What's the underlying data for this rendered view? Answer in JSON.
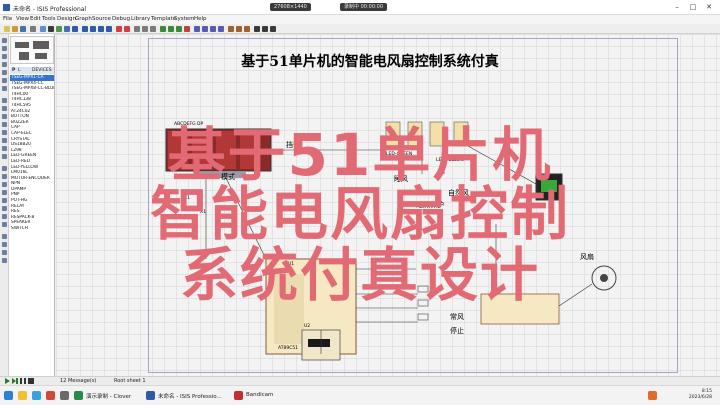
{
  "window": {
    "title": "未命名 - ISIS Professional",
    "overlay_pills": [
      "27608×1440",
      "录制中 00:00:00"
    ],
    "buttons": {
      "minimize": "–",
      "maximize": "□",
      "close": "✕"
    }
  },
  "menu": [
    "File",
    "View",
    "Edit",
    "Tools",
    "Design",
    "Graph",
    "Source",
    "Debug",
    "Library",
    "Template",
    "System",
    "Help"
  ],
  "devices_panel": {
    "header_p": "P",
    "header_l": "L",
    "header_title": "DEVICES",
    "items": [
      "7SEG-MPX1-CA",
      "7SEG-MPX4-CC",
      "7SEG-MPX8-CC-BLUE",
      "74HC00",
      "74HC138",
      "74HC595",
      "AT24C02",
      "BUTTON",
      "BUZZER",
      "CAP",
      "CAP-ELEC",
      "CRYSTAL",
      "DS18B20",
      "L298",
      "LED-GREEN",
      "LED-RED",
      "LED-YELLOW",
      "LM016L",
      "MOTOR-ENCODER",
      "NPN",
      "OPAMP",
      "PNP",
      "POT-HG",
      "RELAY",
      "RES",
      "RESPACK-8",
      "SPEAKER",
      "SWITCH"
    ]
  },
  "schematic": {
    "title": "基于51单片机的智能电风扇控制系统付真",
    "labels": {
      "mode": "模式",
      "gear": "挡位",
      "fan": "风扇",
      "normal_wind": "常风",
      "stop": "停止",
      "sleep": "睡风",
      "overheat": "过热保护",
      "natural": "自然风"
    },
    "small_labels": {
      "lcd_text": "ABCDEFG DP",
      "u1": "U1",
      "u2": "U2",
      "chip": "AT89C51",
      "led_green": "LED-GREEN",
      "led_yellow": "LED-YELLOW",
      "c1": "C1",
      "c3": "C3",
      "x1": "X1"
    }
  },
  "overlay": {
    "line1": "基于51单片机",
    "line2": "智能电风扇控制",
    "line3": "系统付真设计"
  },
  "status": {
    "messages": "12 Message(s)",
    "sheet": "Root sheet 1"
  },
  "taskbar": {
    "items": [
      "演示录制 - Clover",
      "未命名 - ISIS Professio...",
      "Bandicam"
    ],
    "time": "8:15",
    "date": "2023/6/28"
  },
  "colors": {
    "overlay_text": "#e26a74",
    "selected_device": "#3374d0",
    "seg_display": "#8a2a2a",
    "grid_line": "#e3e3e3"
  }
}
